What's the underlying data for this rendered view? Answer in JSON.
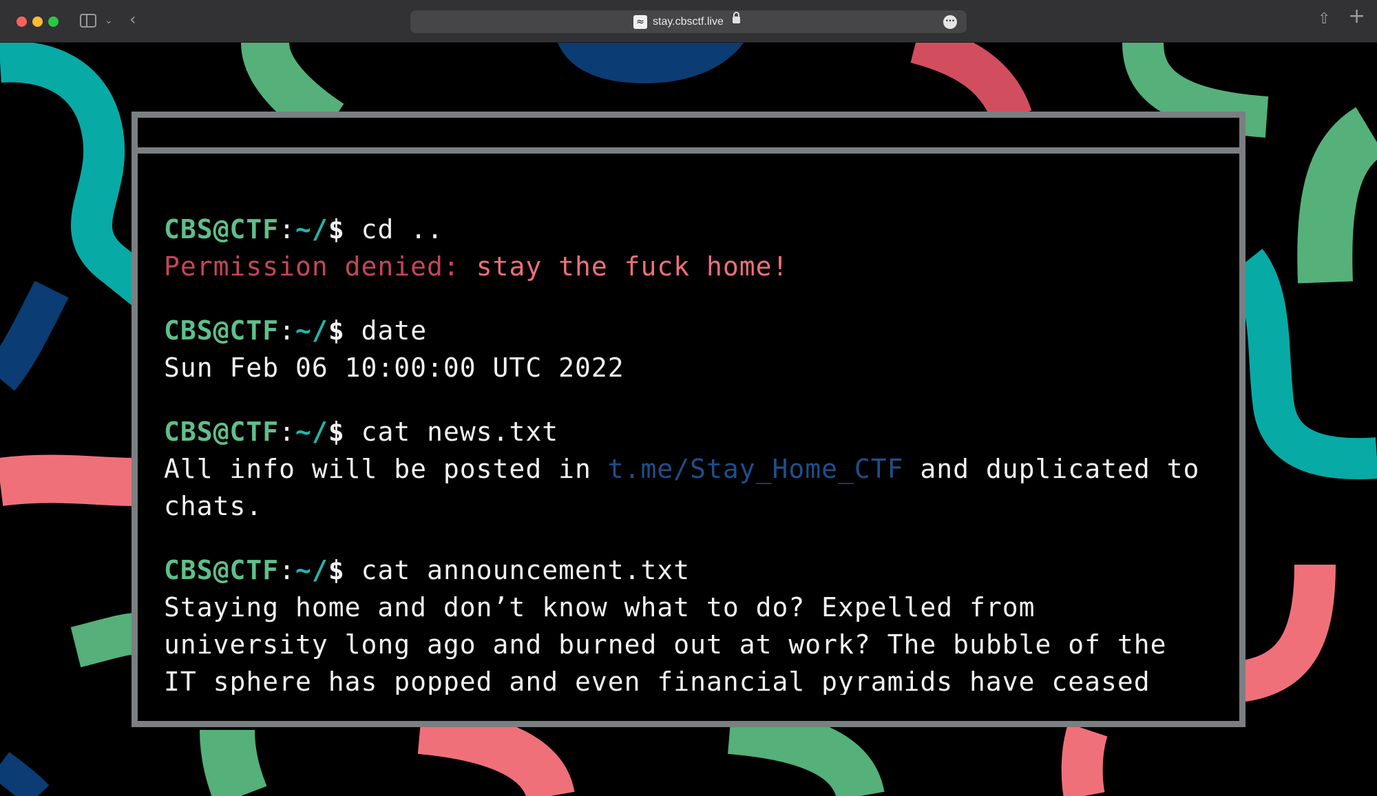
{
  "browser": {
    "url": "stay.cbsctf.live",
    "favicon_icon": "wave-icon"
  },
  "colors": {
    "teal": "#08aaa6",
    "green": "#55b07a",
    "pink": "#f0707a",
    "red": "#d24e5e",
    "navy": "#0b3c73",
    "frame": "#7a7f82"
  },
  "terminal": {
    "prompt": {
      "user": "CBS@CTF",
      "sep": ":",
      "path": "~/",
      "dollar": "$"
    },
    "blocks": [
      {
        "command": " cd ..",
        "output": [
          {
            "part1": "Permission denied:",
            "part2": " stay the fuck home!"
          }
        ]
      },
      {
        "command": " date",
        "output": "Sun Feb 06 10:00:00 UTC 2022"
      },
      {
        "command": " cat news.txt",
        "output_before": "All info will be posted in ",
        "output_link": "t.me/Stay_Home_CTF",
        "output_after": " and duplicated to chats."
      },
      {
        "command": " cat announcement.txt",
        "output": "Staying home and don’t know what to do? Expelled from university long ago and burned out at work? The bubble of the IT sphere has popped and even financial pyramids have ceased"
      }
    ]
  }
}
